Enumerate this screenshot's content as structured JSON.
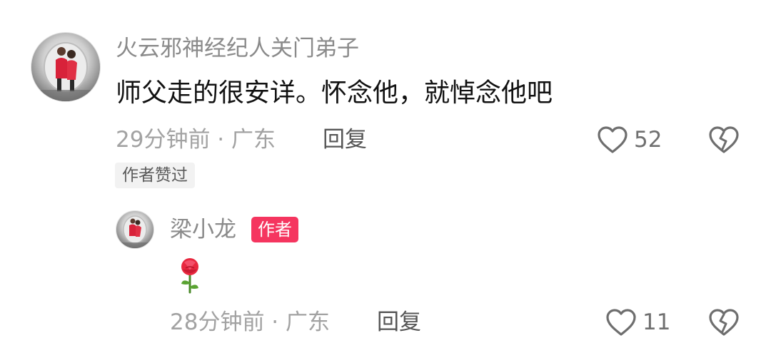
{
  "comment": {
    "username": "火云邪神经纪人关门弟子",
    "text": "师父走的很安详。怀念他，就悼念他吧",
    "meta": "29分钟前 · 广东",
    "reply_label": "回复",
    "like_count": "52",
    "tag": "作者赞过"
  },
  "reply": {
    "username": "梁小龙",
    "author_badge": "作者",
    "emoji": "🌹",
    "meta": "28分钟前 · 广东",
    "reply_label": "回复",
    "like_count": "11"
  },
  "icons": {
    "like": "heart-outline-icon",
    "dislike": "broken-heart-icon",
    "rose": "rose-icon"
  },
  "colors": {
    "author_badge": "#f5355f",
    "meta_text": "#a2a2a2",
    "icon_stroke": "#6e6e6e"
  }
}
